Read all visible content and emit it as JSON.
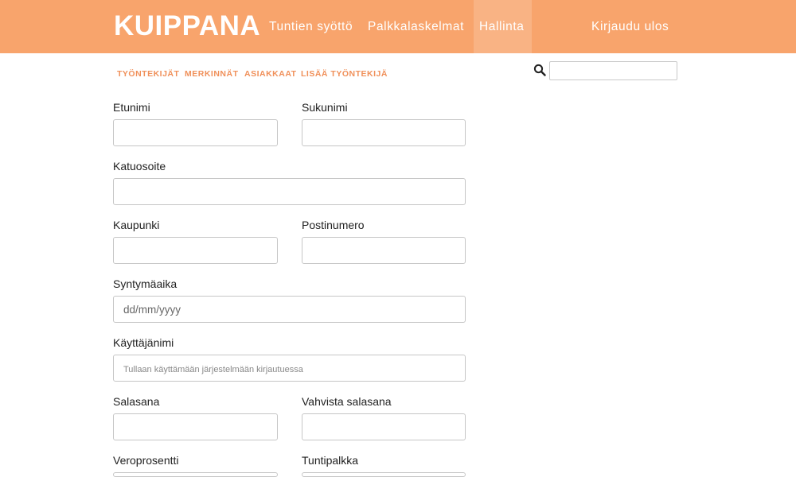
{
  "header": {
    "brand": "KUIPPANA",
    "nav": [
      "Tuntien syöttö",
      "Palkkalaskelmat",
      "Hallinta"
    ],
    "active_nav": "Hallinta",
    "logout": "Kirjaudu ulos",
    "colors": {
      "bar": "#f8a46c",
      "active": "#f9b384",
      "accent": "#f0905a"
    }
  },
  "subnav": [
    "TYÖNTEKIJÄT",
    "MERKINNÄT",
    "ASIAKKAAT",
    "LISÄÄ TYÖNTEKIJÄ"
  ],
  "search": {
    "icon": "search-icon",
    "value": ""
  },
  "form": {
    "first_name": {
      "label": "Etunimi",
      "value": ""
    },
    "last_name": {
      "label": "Sukunimi",
      "value": ""
    },
    "street": {
      "label": "Katuosoite",
      "value": ""
    },
    "city": {
      "label": "Kaupunki",
      "value": ""
    },
    "postal_code": {
      "label": "Postinumero",
      "value": ""
    },
    "birthdate": {
      "label": "Syntymäaika",
      "placeholder": "dd/mm/yyyy"
    },
    "username": {
      "label": "Käyttäjänimi",
      "placeholder": "Tullaan käyttämään järjestelmään kirjautuessa"
    },
    "password": {
      "label": "Salasana",
      "value": ""
    },
    "password_confirm": {
      "label": "Vahvista salasana",
      "value": ""
    },
    "tax_rate": {
      "label": "Veroprosentti",
      "value": ""
    },
    "hourly_wage": {
      "label": "Tuntipalkka",
      "value": ""
    }
  }
}
